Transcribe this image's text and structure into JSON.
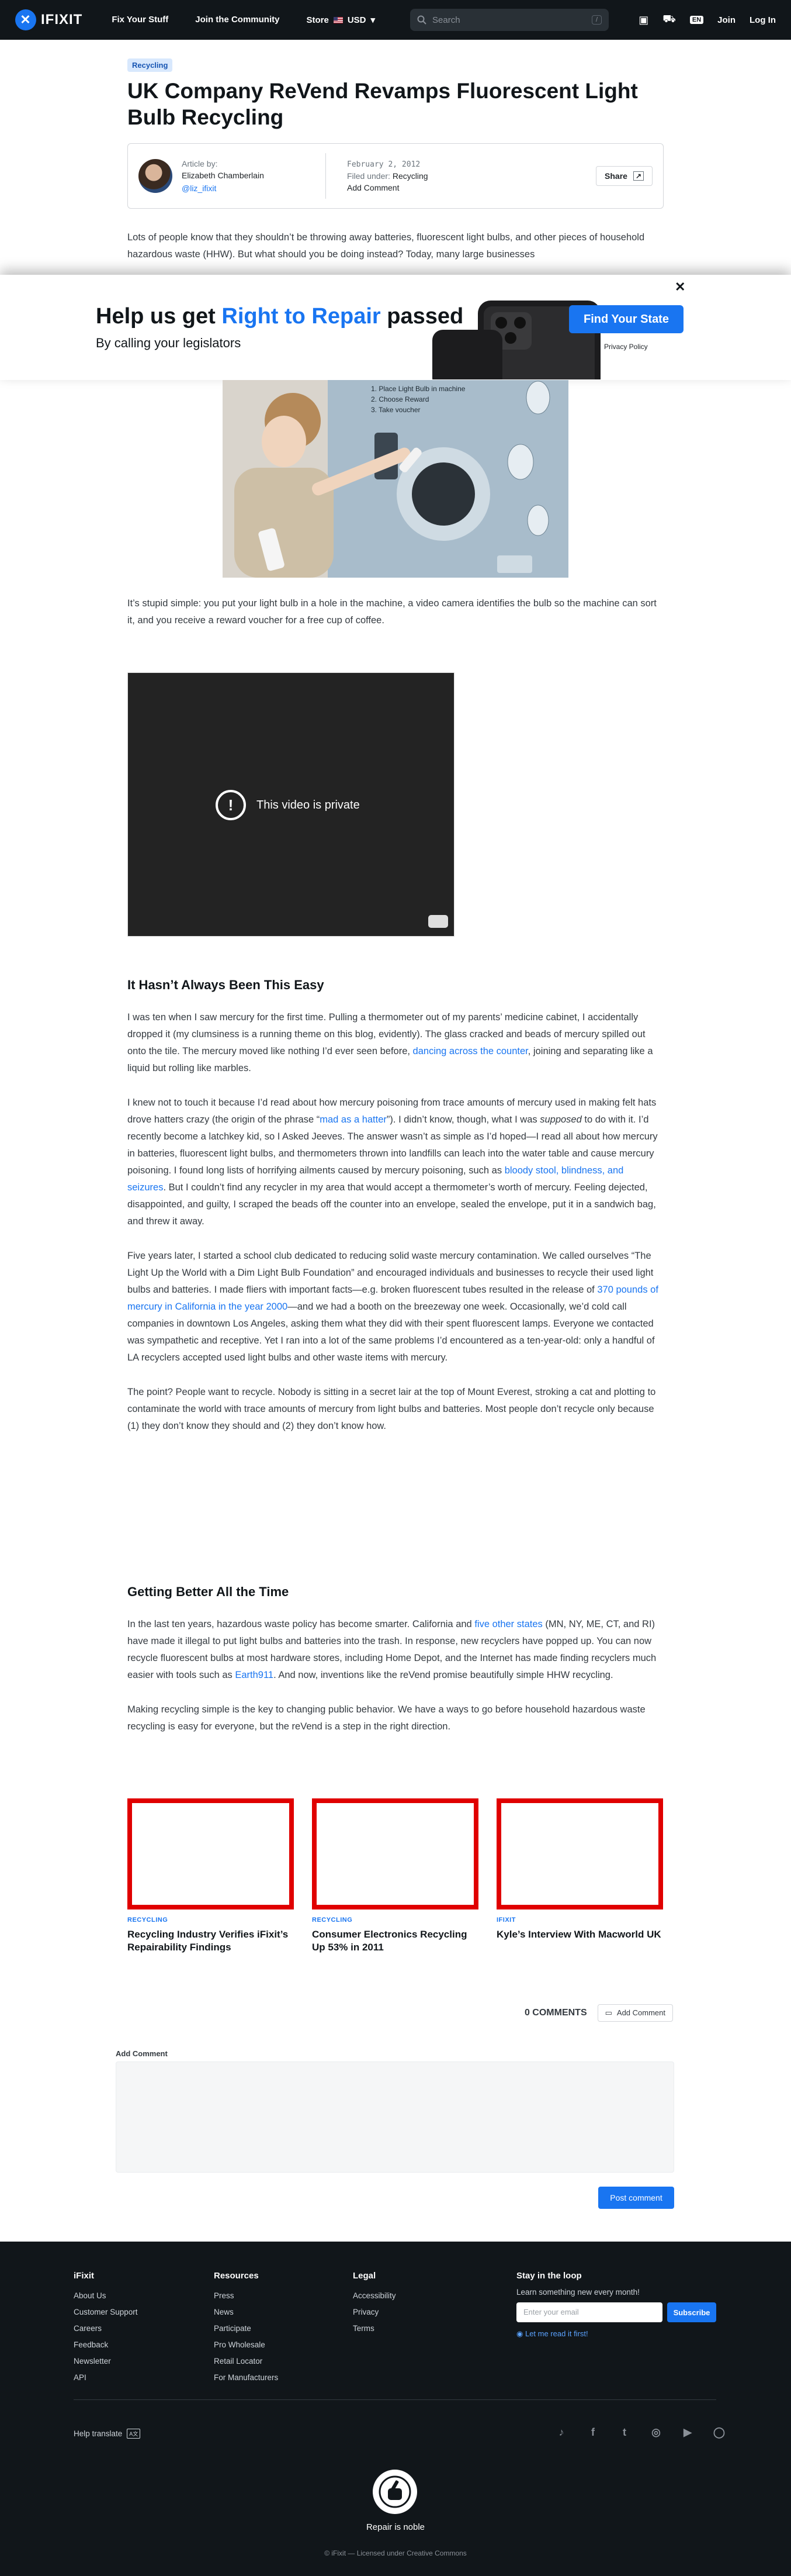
{
  "nav": {
    "logo": "IFIXIT",
    "links": [
      "Fix Your Stuff",
      "Join the Community",
      "Store"
    ],
    "currency": "USD",
    "search_placeholder": "Search",
    "search_shortcut": "/",
    "join": "Join",
    "login": "Log In",
    "lang_badge": "EN"
  },
  "article": {
    "tag": "Recycling",
    "title": "UK Company ReVend Revamps Fluorescent Light Bulb Recycling",
    "byline": {
      "label": "Article by:",
      "author": "Elizabeth Chamberlain",
      "handle": "@liz_ifixit",
      "date": "February 2, 2012",
      "filed_label": "Filed under:",
      "filed_value": "Recycling",
      "add_comment": "Add Comment",
      "share": "Share"
    },
    "intro": "Lots of people know that they shouldn’t be throwing away batteries, fluorescent light bulbs, and other pieces of household hazardous waste (HHW). But what should you be doing instead? Today, many large businesses",
    "photo_steps": [
      "1. Place Light Bulb in machine",
      "2. Choose Reward",
      "3. Take voucher"
    ],
    "p_simple": "It’s stupid simple: you put your light bulb in a hole in the machine, a video camera identifies the bulb so the machine can sort it, and you receive a reward voucher for a free cup of coffee.",
    "video_message": "This video is private",
    "h_easy": "It Hasn’t Always Been This Easy",
    "p1": {
      "a": "I was ten when I saw mercury for the first time. Pulling a thermometer out of my parents’ medicine cabinet, I accidentally dropped it (my clumsiness is a running theme on this blog, evidently). The glass cracked and beads of mercury spilled out onto the tile. The mercury moved like nothing I’d ever seen before, ",
      "link": "dancing across the counter",
      "b": ", joining and separating like a liquid but rolling like marbles."
    },
    "p2": {
      "a": "I knew not to touch it because I’d read about how mercury poisoning from trace amounts of mercury used in making felt hats drove hatters crazy (the origin of the phrase “",
      "link1": "mad as a hatter",
      "b": "”). I didn’t know, though, what I was ",
      "em": "supposed",
      "c": " to do with it. I’d recently become a latchkey kid, so I Asked Jeeves. The answer wasn’t as simple as I’d hoped—I read all about how mercury in batteries, fluorescent light bulbs, and thermometers thrown into landfills can leach into the water table and cause mercury poisoning. I found long lists of horrifying ailments caused by mercury poisoning, such as ",
      "link2": "bloody stool, blindness, and seizures",
      "d": ". But I couldn’t find any recycler in my area that would accept a thermometer’s worth of mercury. Feeling dejected, disappointed, and guilty, I scraped the beads off the counter into an envelope, sealed the envelope, put it in a sandwich bag, and threw it away."
    },
    "p3": {
      "a": "Five years later, I started a school club dedicated to reducing solid waste mercury contamination. We called ourselves “The Light Up the World with a Dim Light Bulb Foundation” and encouraged individuals and businesses to recycle their used light bulbs and batteries. I made fliers with important facts—e.g. broken fluorescent tubes resulted in the release of ",
      "link": "370 pounds of mercury in California in the year 2000",
      "b": "—and we had a booth on the breezeway one week. Occasionally, we’d cold call companies in downtown Los Angeles, asking them what they did with their spent fluorescent lamps. Everyone we contacted was sympathetic and receptive. Yet I ran into a lot of the same problems I’d encountered as a ten-year-old: only a handful of LA recyclers accepted used light bulbs and other waste items with mercury."
    },
    "p4": "The point? People want to recycle. Nobody is sitting in a secret lair at the top of Mount Everest, stroking a cat and plotting to contaminate the world with trace amounts of mercury from light bulbs and batteries. Most people don’t recycle only because (1) they don’t know they should and (2) they don’t know how.",
    "h_better": "Getting Better All the Time",
    "p5": {
      "a": "In the last ten years, hazardous waste policy has become smarter. California and ",
      "link1": "five other states",
      "b": " (MN, NY, ME, CT, and RI) have made it illegal to put light bulbs and batteries into the trash. In response, new recyclers have popped up. You can now recycle fluorescent bulbs at most hardware stores, including Home Depot, and the Internet has made finding recyclers much easier with tools such as ",
      "link2": "Earth911",
      "c": ". And now, inventions like the reVend promise beautifully simple HHW recycling."
    },
    "p6": "Making recycling simple is the key to changing public behavior. We have a ways to go before household hazardous waste recycling is easy for everyone, but the reVend is a step in the right direction."
  },
  "overlay": {
    "title_a": "Help us get ",
    "title_hl": "Right to Repair",
    "title_b": " passed",
    "subtitle": "By calling your legislators",
    "button": "Find Your State",
    "privacy": "Privacy Policy",
    "close": "✕"
  },
  "related": [
    {
      "category": "RECYCLING",
      "title": "Recycling Industry Verifies iFixit’s Repairability Findings"
    },
    {
      "category": "RECYCLING",
      "title": "Consumer Electronics Recycling Up 53% in 2011"
    },
    {
      "category": "IFIXIT",
      "title": "Kyle’s Interview With Macworld UK"
    }
  ],
  "comments": {
    "count": "0 COMMENTS",
    "add_button": "Add Comment",
    "add_label": "Add Comment",
    "post": "Post comment"
  },
  "footer": {
    "ifixit": {
      "heading": "iFixit",
      "links": [
        "About Us",
        "Customer Support",
        "Careers",
        "Feedback",
        "Newsletter",
        "API"
      ]
    },
    "resources": {
      "heading": "Resources",
      "links": [
        "Press",
        "News",
        "Participate",
        "Pro Wholesale",
        "Retail Locator",
        "For Manufacturers"
      ]
    },
    "legal": {
      "heading": "Legal",
      "links": [
        "Accessibility",
        "Privacy",
        "Terms"
      ]
    },
    "newsletter": {
      "heading": "Stay in the loop",
      "text": "Learn something new every month!",
      "placeholder": "Enter your email",
      "button": "Subscribe",
      "read_first": "Let me read it first!"
    },
    "help_translate": "Help translate",
    "slogan": "Repair is noble",
    "copyright": "© iFixit — Licensed under Creative Commons"
  },
  "colors": {
    "accent": "#1975f1",
    "nav_bg": "#11161a",
    "card_border": "#e00000"
  }
}
